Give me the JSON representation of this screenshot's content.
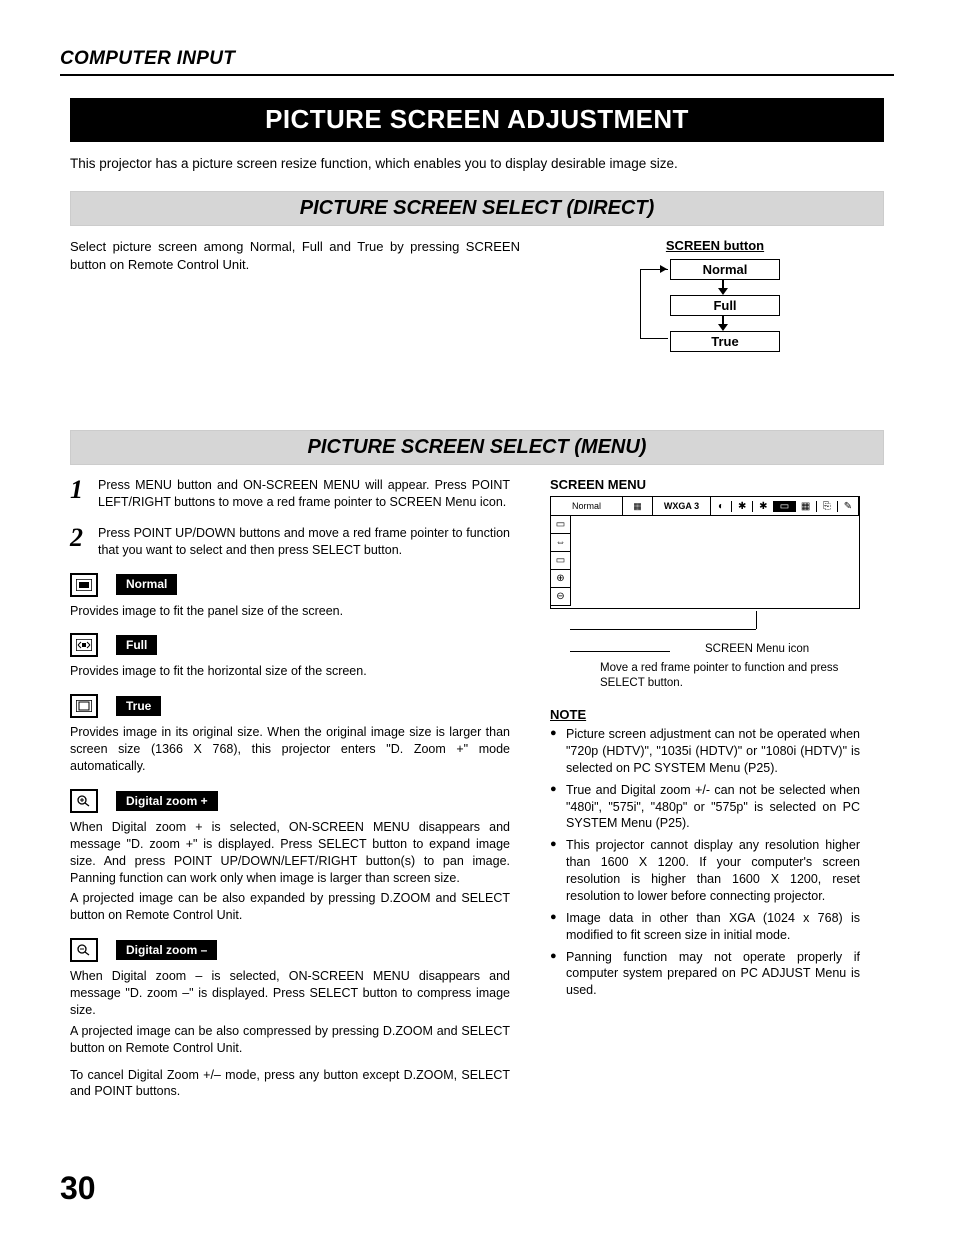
{
  "header": {
    "section": "COMPUTER INPUT"
  },
  "title": "PICTURE SCREEN ADJUSTMENT",
  "intro": "This projector has a picture screen resize function, which enables you to display desirable image size.",
  "direct": {
    "heading": "PICTURE SCREEN SELECT (DIRECT)",
    "text": "Select picture screen among Normal, Full and True by pressing SCREEN button on Remote Control Unit.",
    "button_label": "SCREEN button",
    "cycle": [
      "Normal",
      "Full",
      "True"
    ]
  },
  "menu": {
    "heading": "PICTURE SCREEN SELECT (MENU)",
    "steps": [
      {
        "num": "1",
        "text": "Press MENU button and ON-SCREEN MENU will appear.  Press POINT LEFT/RIGHT buttons to move a red frame pointer to SCREEN Menu icon."
      },
      {
        "num": "2",
        "text": "Press POINT UP/DOWN buttons and move a red frame pointer to function that you want to select and then press SELECT button."
      }
    ],
    "options": [
      {
        "key": "normal",
        "label": "Normal",
        "desc": [
          "Provides image to fit the panel size of the screen."
        ]
      },
      {
        "key": "full",
        "label": "Full",
        "desc": [
          "Provides image to fit the horizontal size of the screen."
        ]
      },
      {
        "key": "true",
        "label": "True",
        "desc": [
          "Provides image in its original size. When the original image size is larger than screen size (1366 X 768), this projector enters \"D. Zoom +\" mode automatically."
        ]
      },
      {
        "key": "dzoom_plus",
        "label": "Digital zoom +",
        "desc": [
          "When Digital zoom + is selected, ON-SCREEN MENU disappears and message \"D. zoom +\" is displayed.  Press SELECT button to expand image size.  And press POINT UP/DOWN/LEFT/RIGHT button(s) to pan image.  Panning function can work only when image is larger than screen size.",
          "A projected image can be also expanded by pressing D.ZOOM and SELECT button on Remote Control Unit."
        ]
      },
      {
        "key": "dzoom_minus",
        "label": "Digital zoom –",
        "desc": [
          "When Digital zoom – is selected, ON-SCREEN MENU disappears and message \"D. zoom –\" is displayed.  Press SELECT button to compress image size.",
          "A projected image can be also compressed by pressing D.ZOOM and SELECT button on Remote Control Unit."
        ]
      }
    ],
    "cancel": "To cancel Digital Zoom +/– mode, press any button except D.ZOOM, SELECT and POINT buttons."
  },
  "screen_menu": {
    "title": "SCREEN MENU",
    "top_label": "Normal",
    "sys_label": "WXGA 3",
    "icon_label": "SCREEN Menu icon",
    "pointer_label": "Move a red frame pointer to function and press SELECT button."
  },
  "note": {
    "title": "NOTE",
    "items": [
      "Picture screen adjustment can not be operated when \"720p (HDTV)\", \"1035i (HDTV)\" or \"1080i (HDTV)\" is selected on PC SYSTEM Menu  (P25).",
      "True and Digital zoom +/- can not be selected when \"480i\", \"575i\", \"480p\" or \"575p\" is selected on PC SYSTEM Menu  (P25).",
      "This projector cannot display any resolution higher than 1600 X 1200.  If your computer's screen resolution is higher than 1600 X 1200, reset resolution to lower before connecting projector.",
      "Image data in other than XGA (1024 x 768) is modified to fit screen size in initial mode.",
      "Panning function may not operate properly if computer system prepared on PC ADJUST Menu is used."
    ]
  },
  "page_number": "30"
}
